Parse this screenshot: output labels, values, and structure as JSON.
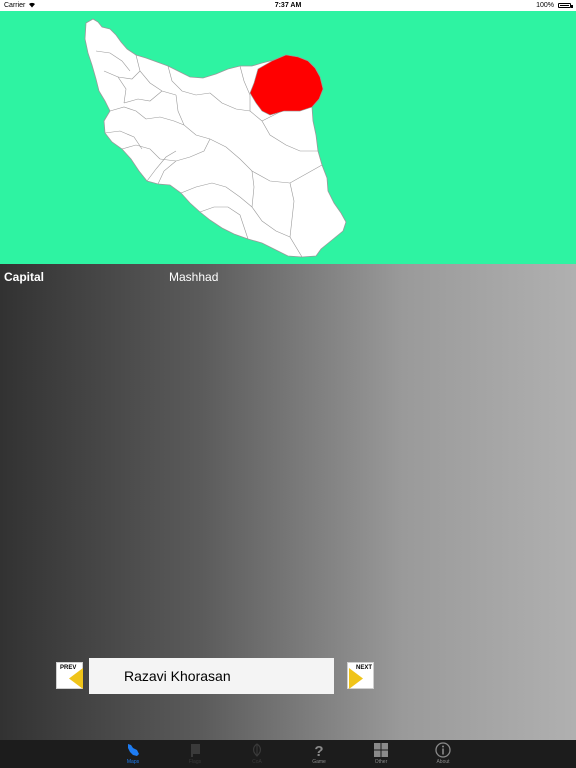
{
  "status_bar": {
    "carrier": "Carrier",
    "time": "7:37 AM",
    "battery": "100%"
  },
  "map": {
    "background_color": "#2ef3a2",
    "land_color": "#ffffff",
    "highlight_color": "#ff0000",
    "highlighted_region": "Razavi Khorasan"
  },
  "info": {
    "capital_label": "Capital",
    "capital_value": "Mashhad"
  },
  "navigation": {
    "prev_label": "PREV",
    "next_label": "NEXT",
    "region_name": "Razavi Khorasan",
    "arrow_color": "#f0c419"
  },
  "tab_bar": {
    "active_color": "#1e7cf2",
    "inactive_color": "#8a8a8a",
    "disabled_color": "#3a3a3a",
    "tabs": [
      {
        "label": "Maps",
        "icon": "map-icon",
        "state": "active"
      },
      {
        "label": "Flags",
        "icon": "flag-icon",
        "state": "disabled"
      },
      {
        "label": "CoA",
        "icon": "emblem-icon",
        "state": "disabled"
      },
      {
        "label": "Game",
        "icon": "question-icon",
        "state": "normal"
      },
      {
        "label": "Other",
        "icon": "grid-icon",
        "state": "normal"
      },
      {
        "label": "About",
        "icon": "info-icon",
        "state": "normal"
      }
    ]
  }
}
